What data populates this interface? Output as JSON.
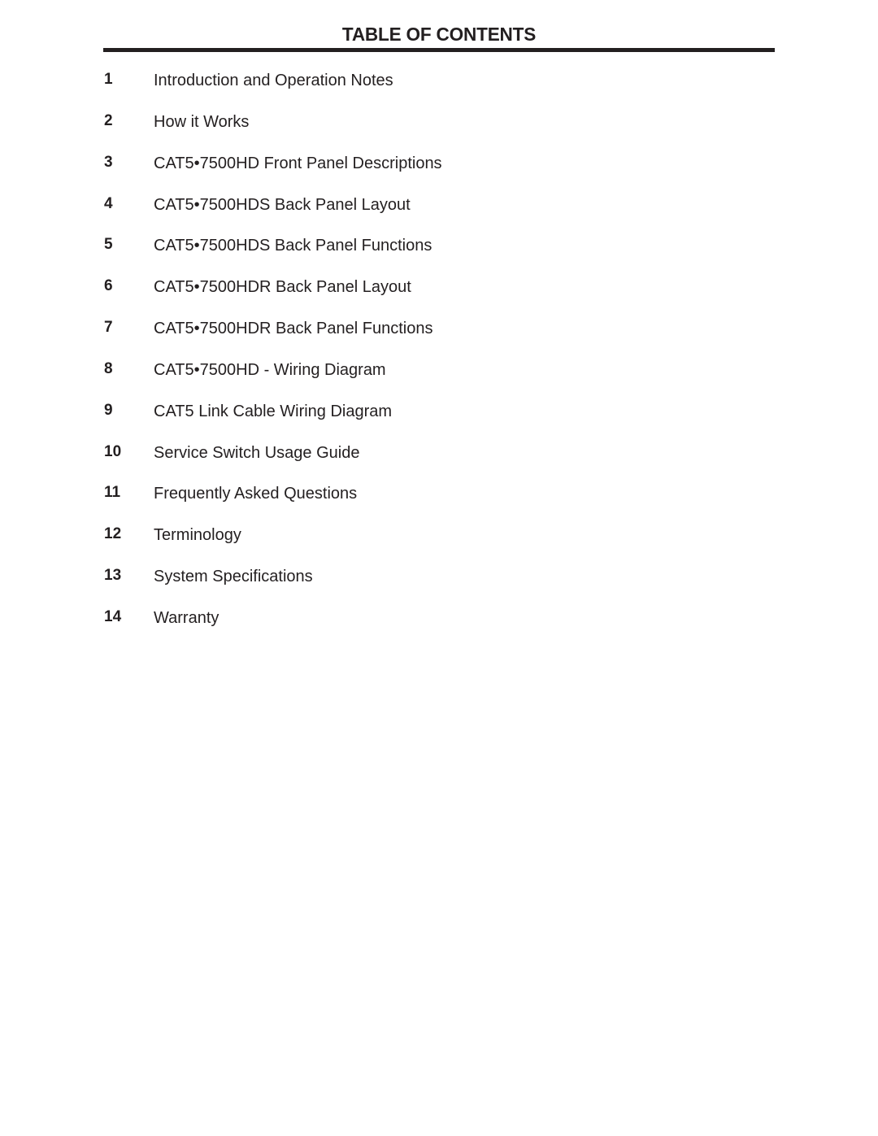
{
  "document": {
    "title": "TABLE OF CONTENTS",
    "entries": [
      {
        "number": "1",
        "label": "Introduction and Operation Notes"
      },
      {
        "number": "2",
        "label": "How it Works"
      },
      {
        "number": "3",
        "label": "CAT5•7500HD Front Panel Descriptions"
      },
      {
        "number": "4",
        "label": "CAT5•7500HDS Back Panel Layout"
      },
      {
        "number": "5",
        "label": "CAT5•7500HDS Back Panel Functions"
      },
      {
        "number": "6",
        "label": "CAT5•7500HDR Back Panel Layout"
      },
      {
        "number": "7",
        "label": "CAT5•7500HDR Back Panel Functions"
      },
      {
        "number": "8",
        "label": "CAT5•7500HD - Wiring Diagram"
      },
      {
        "number": "9",
        "label": "CAT5 Link Cable Wiring Diagram"
      },
      {
        "number": "10",
        "label": "Service Switch Usage Guide"
      },
      {
        "number": "11",
        "label": "Frequently Asked Questions"
      },
      {
        "number": "12",
        "label": "Terminology"
      },
      {
        "number": "13",
        "label": "System Specifications"
      },
      {
        "number": "14",
        "label": "Warranty"
      }
    ]
  },
  "colors": {
    "text": "#231f20",
    "rule": "#231f20",
    "background": "#ffffff"
  }
}
